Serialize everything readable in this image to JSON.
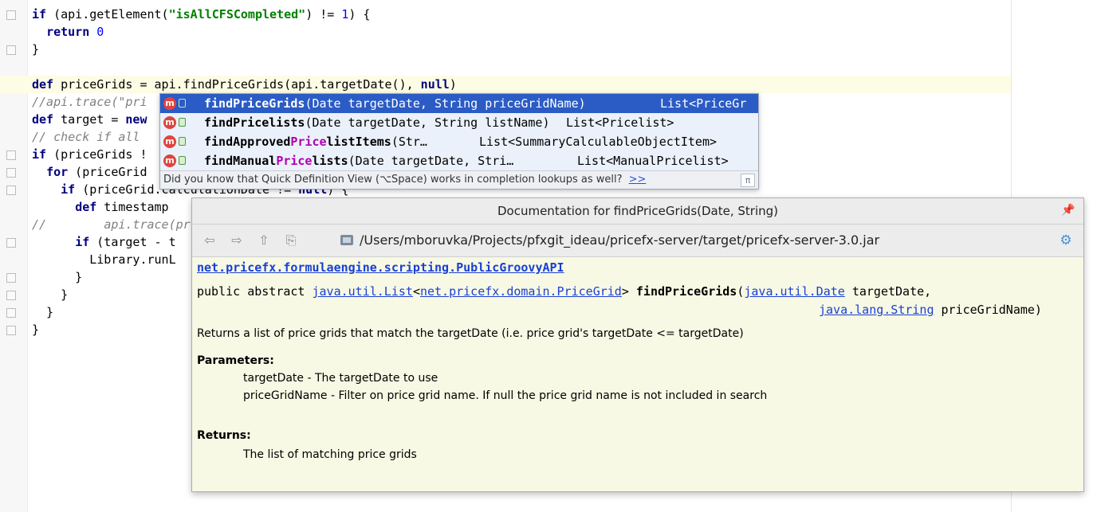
{
  "editor": {
    "lines": [
      {
        "parts": [
          {
            "c": "kw",
            "t": "if"
          },
          {
            "c": "",
            "t": " (api.getElement("
          },
          {
            "c": "str",
            "t": "\"isAllCFSCompleted\""
          },
          {
            "c": "",
            "t": ") != "
          },
          {
            "c": "num",
            "t": "1"
          },
          {
            "c": "",
            "t": ") {"
          }
        ]
      },
      {
        "parts": [
          {
            "c": "",
            "t": "  "
          },
          {
            "c": "kw",
            "t": "return"
          },
          {
            "c": "",
            "t": " "
          },
          {
            "c": "num",
            "t": "0"
          }
        ]
      },
      {
        "parts": [
          {
            "c": "",
            "t": "}"
          }
        ]
      },
      {
        "parts": [
          {
            "c": "",
            "t": ""
          }
        ]
      },
      {
        "parts": [
          {
            "c": "kw",
            "t": "def"
          },
          {
            "c": "",
            "t": " priceGrids = api.findPriceGrids(api.targetDate(), "
          },
          {
            "c": "kw",
            "t": "null"
          },
          {
            "c": "",
            "t": ")"
          }
        ]
      },
      {
        "parts": [
          {
            "c": "cmt",
            "t": "//api.trace(\"pri"
          }
        ]
      },
      {
        "parts": [
          {
            "c": "kw",
            "t": "def"
          },
          {
            "c": "",
            "t": " target = "
          },
          {
            "c": "kw",
            "t": "new"
          }
        ]
      },
      {
        "parts": [
          {
            "c": "cmt",
            "t": "// check if all"
          }
        ]
      },
      {
        "parts": [
          {
            "c": "kw",
            "t": "if"
          },
          {
            "c": "",
            "t": " (priceGrids !"
          }
        ]
      },
      {
        "parts": [
          {
            "c": "",
            "t": "  "
          },
          {
            "c": "kw",
            "t": "for"
          },
          {
            "c": "",
            "t": " (priceGrid"
          }
        ]
      },
      {
        "parts": [
          {
            "c": "",
            "t": "    "
          },
          {
            "c": "kw",
            "t": "if"
          },
          {
            "c": "",
            "t": " (priceGrid.calculationDate != "
          },
          {
            "c": "kw",
            "t": "null"
          },
          {
            "c": "",
            "t": ") {"
          }
        ]
      },
      {
        "parts": [
          {
            "c": "",
            "t": "      "
          },
          {
            "c": "kw",
            "t": "def"
          },
          {
            "c": "",
            "t": " timestamp"
          }
        ]
      },
      {
        "parts": [
          {
            "c": "cmt",
            "t": "//"
          },
          {
            "c": "",
            "t": "        "
          },
          {
            "c": "cmt",
            "t": "api.trace(pr"
          }
        ]
      },
      {
        "parts": [
          {
            "c": "",
            "t": "      "
          },
          {
            "c": "kw",
            "t": "if"
          },
          {
            "c": "",
            "t": " (target - t"
          }
        ]
      },
      {
        "parts": [
          {
            "c": "",
            "t": "        Library.runL"
          }
        ]
      },
      {
        "parts": [
          {
            "c": "",
            "t": "      }"
          }
        ]
      },
      {
        "parts": [
          {
            "c": "",
            "t": "    }"
          }
        ]
      },
      {
        "parts": [
          {
            "c": "",
            "t": "  }"
          }
        ]
      },
      {
        "parts": [
          {
            "c": "",
            "t": "}"
          }
        ]
      }
    ]
  },
  "completion": {
    "items": [
      {
        "name_pre": "",
        "name_hl": "findPriceGrids",
        "name_post": "",
        "params": "(Date targetDate, String priceGridName)",
        "ret": "List<PriceGr",
        "selected": true
      },
      {
        "name_pre": "findPrice",
        "name_hl": "",
        "name_post": "lists",
        "params": "(Date targetDate, String listName)",
        "ret": "List<Pricelist>",
        "selected": false
      },
      {
        "name_pre": "findApproved",
        "name_hl": "Price",
        "name_post": "listItems",
        "params": "(Str…",
        "ret": "List<SummaryCalculableObjectItem>",
        "selected": false
      },
      {
        "name_pre": "findManual",
        "name_hl": "Price",
        "name_post": "lists",
        "params": "(Date targetDate, Stri…",
        "ret": "List<ManualPricelist>",
        "selected": false
      }
    ],
    "icon_label": "m",
    "hint": "Did you know that Quick Definition View (⌥Space) works in completion lookups as well?",
    "hint_link": ">>",
    "pi": "π"
  },
  "doc": {
    "title": "Documentation for findPriceGrids(Date, String)",
    "path": "/Users/mboruvka/Projects/pfxgit_ideau/pricefx-server/target/pricefx-server-3.0.jar",
    "class_link": "net.pricefx.formulaengine.scripting.PublicGroovyAPI",
    "decl": {
      "prefix": "public abstract ",
      "list_type": "java.util.List",
      "lt": "<",
      "grid_type": "net.pricefx.domain.PriceGrid",
      "gt": "> ",
      "method": "findPriceGrids",
      "open": "(",
      "date_type": "java.util.Date",
      "param1": " targetDate,",
      "string_type": "java.lang.String",
      "param2": " priceGridName)"
    },
    "description": "Returns a list of price grids that match the targetDate (i.e. price grid's targetDate <= targetDate)",
    "parameters_heading": "Parameters:",
    "param_lines": [
      "targetDate - The targetDate to use",
      "priceGridName - Filter on price grid name. If null the price grid name is not included in search"
    ],
    "returns_heading": "Returns:",
    "returns_text": "The list of matching price grids"
  }
}
